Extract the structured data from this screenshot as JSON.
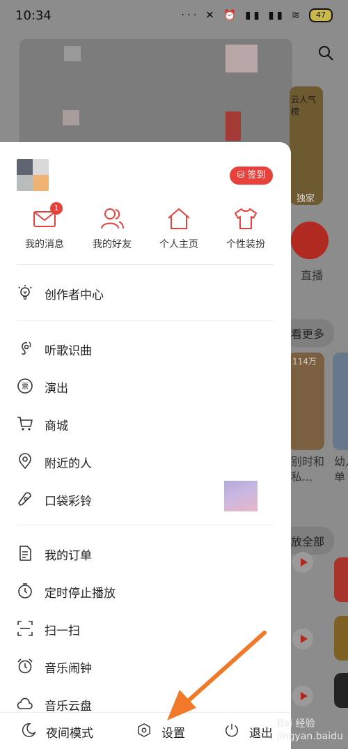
{
  "status_bar": {
    "time": "10:34",
    "icons": "··· ✕ ⏰ ▮▮ ▮▮ ≋",
    "battery": "47"
  },
  "background": {
    "banner_text_top": "云人气榜",
    "exclusive_badge": "独家",
    "live_label": "直播",
    "see_more": "看更多",
    "playlist_count": "114万",
    "card1_text": "别时和\n私...",
    "card2_text": "幼儿\n单",
    "play_all": "放全部"
  },
  "drawer": {
    "sign_in": "签到",
    "quick_actions": [
      {
        "label": "我的消息",
        "icon": "mail-icon",
        "badge": "1"
      },
      {
        "label": "我的好友",
        "icon": "friends-icon"
      },
      {
        "label": "个人主页",
        "icon": "home-icon"
      },
      {
        "label": "个性装扮",
        "icon": "shirt-icon"
      }
    ],
    "section1": [
      {
        "label": "创作者中心",
        "icon": "lightbulb-icon"
      }
    ],
    "section2": [
      {
        "label": "听歌识曲",
        "icon": "mic-icon"
      },
      {
        "label": "演出",
        "icon": "ticket-icon"
      },
      {
        "label": "商城",
        "icon": "cart-icon"
      },
      {
        "label": "附近的人",
        "icon": "location-icon"
      },
      {
        "label": "口袋彩铃",
        "icon": "ringtone-icon"
      }
    ],
    "section3": [
      {
        "label": "我的订单",
        "icon": "order-icon"
      },
      {
        "label": "定时停止播放",
        "icon": "timer-icon"
      },
      {
        "label": "扫一扫",
        "icon": "scan-icon"
      },
      {
        "label": "音乐闹钟",
        "icon": "alarm-icon"
      },
      {
        "label": "音乐云盘",
        "icon": "cloud-icon"
      }
    ],
    "bottom": {
      "night_mode": "夜间模式",
      "settings": "设置",
      "logout": "退出"
    }
  },
  "watermark": "Bai 经验\njingyan.baidu",
  "colors": {
    "accent": "#e8413b",
    "arrow": "#f07a2a",
    "overlay": "#8c8c8c"
  }
}
